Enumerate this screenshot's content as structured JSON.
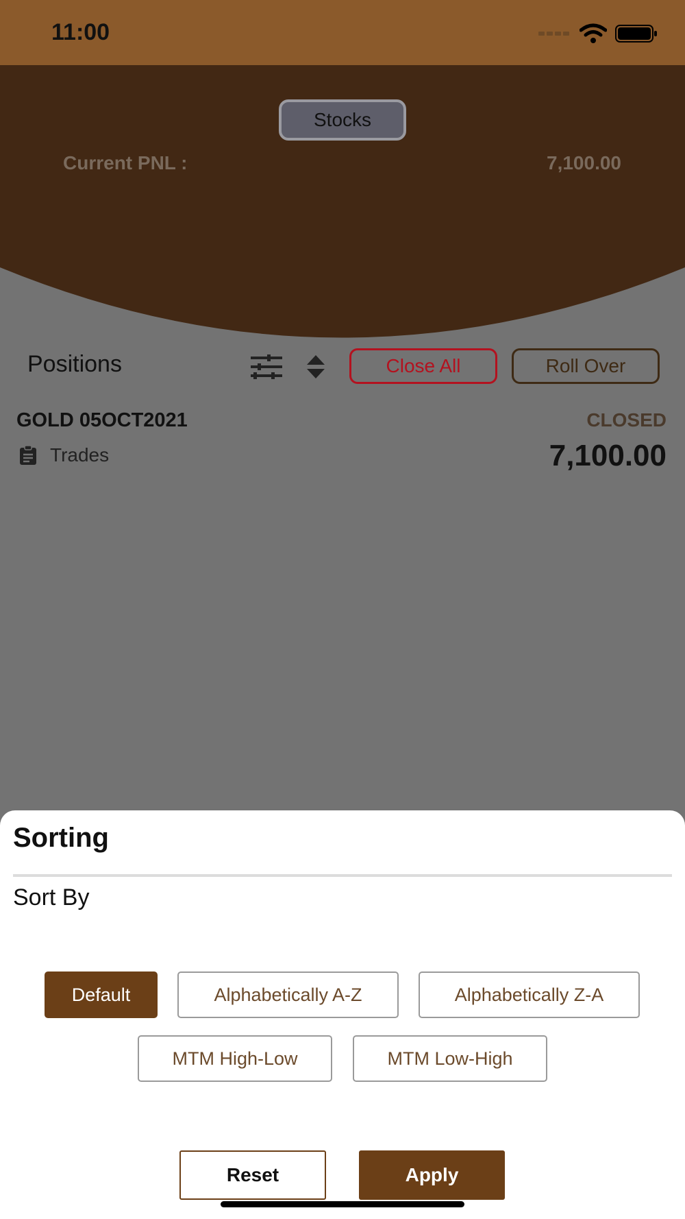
{
  "status_bar": {
    "time": "11:00"
  },
  "header": {
    "segment_label": "Stocks",
    "pnl_label": "Current PNL :",
    "pnl_value": "7,100.00"
  },
  "positions": {
    "title": "Positions",
    "close_all_label": "Close All",
    "roll_over_label": "Roll Over",
    "items": [
      {
        "symbol": "GOLD 05OCT2021",
        "status": "CLOSED",
        "trades_label": "Trades",
        "value": "7,100.00"
      }
    ]
  },
  "sorting_sheet": {
    "title": "Sorting",
    "sort_by_label": "Sort By",
    "options": [
      {
        "label": "Default",
        "selected": true
      },
      {
        "label": "Alphabetically A-Z",
        "selected": false
      },
      {
        "label": "Alphabetically Z-A",
        "selected": false
      },
      {
        "label": "MTM High-Low",
        "selected": false
      },
      {
        "label": "MTM Low-High",
        "selected": false
      }
    ],
    "reset_label": "Reset",
    "apply_label": "Apply"
  },
  "colors": {
    "status_bar": "#8b5a2b",
    "header_brown": "#422814",
    "overlay_gray": "#737373",
    "accent_brown": "#6b3f17",
    "close_red": "#b3121f"
  },
  "icons": [
    "wifi-icon",
    "battery-icon",
    "signal-icon",
    "filter-icon",
    "sort-icon",
    "clipboard-icon"
  ]
}
